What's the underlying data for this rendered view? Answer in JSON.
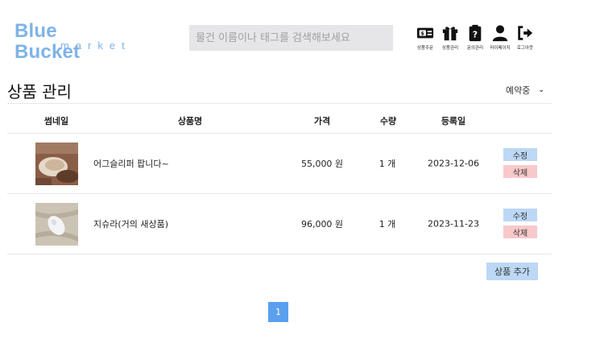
{
  "header": {
    "logo_title": "Blue Bucket",
    "logo_sub": "market",
    "search_placeholder": "물건 이름이나 태그를 검색해보세요",
    "nav": [
      {
        "label": "상품주문",
        "icon": "money-icon"
      },
      {
        "label": "상품관리",
        "icon": "gift-icon"
      },
      {
        "label": "문의관리",
        "icon": "clipboard-question-icon"
      },
      {
        "label": "마이페이지",
        "icon": "user-icon"
      },
      {
        "label": "로그아웃",
        "icon": "logout-icon"
      }
    ]
  },
  "main": {
    "title": "상품 관리",
    "sort_selected": "예약중",
    "columns": [
      "썸네일",
      "상품명",
      "가격",
      "수량",
      "등록일"
    ],
    "rows": [
      {
        "name": "어그슬리퍼 팝니다~",
        "price": "55,000 원",
        "qty": "1 개",
        "date": "2023-12-06",
        "edit": "수정",
        "delete": "삭제"
      },
      {
        "name": "지슈라(거의 새상품)",
        "price": "96,000 원",
        "qty": "1 개",
        "date": "2023-11-23",
        "edit": "수정",
        "delete": "삭제"
      }
    ],
    "add_label": "상품 추가",
    "pagination": {
      "current": "1"
    }
  },
  "colors": {
    "brand": "#7fb3e8",
    "edit_button": "#bcd8f5",
    "delete_button": "#f8c9cb",
    "active_page": "#5aa0ee"
  }
}
